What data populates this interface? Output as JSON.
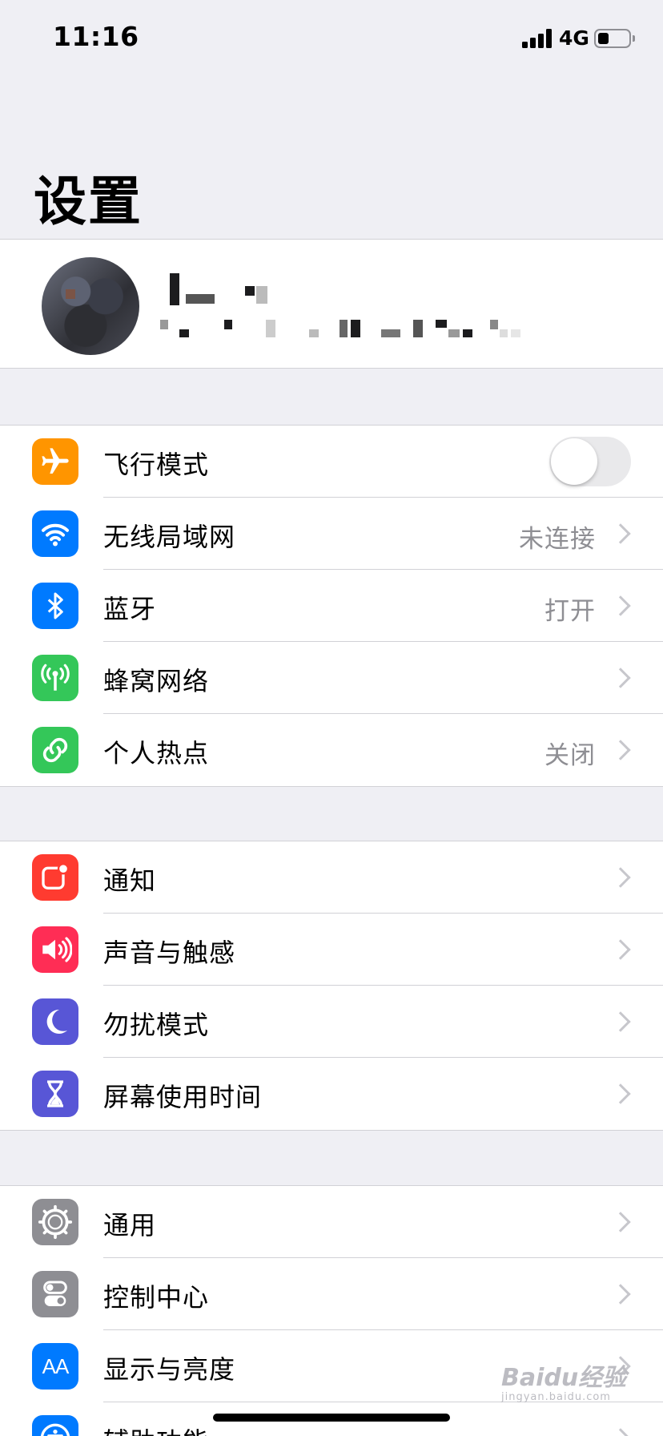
{
  "status_bar": {
    "time": "11:16",
    "network": "4G",
    "battery_level": 0.35
  },
  "page": {
    "title": "设置"
  },
  "groups": [
    [
      {
        "label": "飞行模式",
        "icon": "airplane-icon",
        "color": "#ff9500",
        "toggle": true,
        "toggle_on": false
      },
      {
        "label": "无线局域网",
        "icon": "wifi-icon",
        "color": "#007aff",
        "value": "未连接"
      },
      {
        "label": "蓝牙",
        "icon": "bluetooth-icon",
        "color": "#007aff",
        "value": "打开"
      },
      {
        "label": "蜂窝网络",
        "icon": "antenna-icon",
        "color": "#34c759",
        "value": ""
      },
      {
        "label": "个人热点",
        "icon": "hotspot-link-icon",
        "color": "#34c759",
        "value": "关闭"
      }
    ],
    [
      {
        "label": "通知",
        "icon": "notification-icon",
        "color": "#ff3b30"
      },
      {
        "label": "声音与触感",
        "icon": "speaker-icon",
        "color": "#ff2d55"
      },
      {
        "label": "勿扰模式",
        "icon": "moon-icon",
        "color": "#5856d6"
      },
      {
        "label": "屏幕使用时间",
        "icon": "hourglass-icon",
        "color": "#5856d6"
      }
    ],
    [
      {
        "label": "通用",
        "icon": "gear-icon",
        "color": "#8e8e93"
      },
      {
        "label": "控制中心",
        "icon": "toggles-icon",
        "color": "#8e8e93"
      },
      {
        "label": "显示与亮度",
        "icon": "text-size-icon",
        "color": "#007aff",
        "icon_text": "AA"
      },
      {
        "label": "辅助功能",
        "icon": "accessibility-icon",
        "color": "#007aff"
      }
    ]
  ],
  "watermark": {
    "text": "Baidu经验",
    "sub": "jingyan.baidu.com"
  }
}
